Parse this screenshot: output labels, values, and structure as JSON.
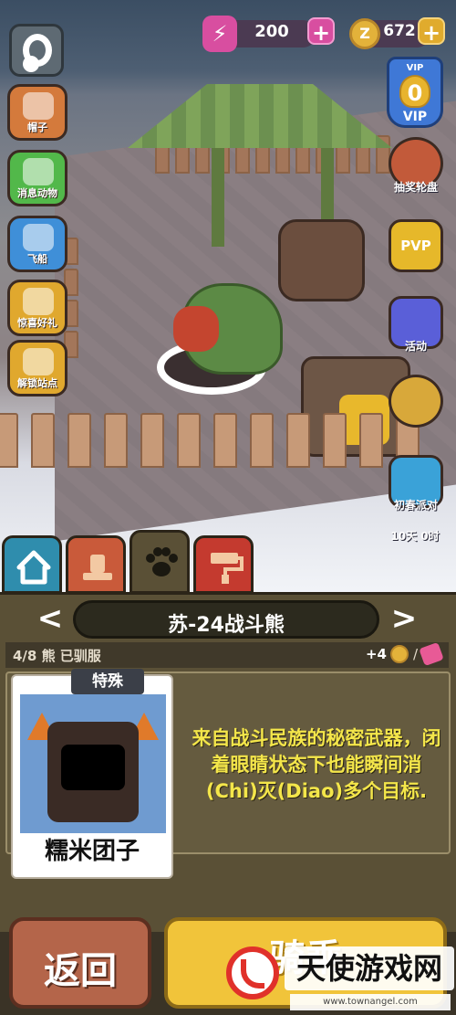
{
  "top_bar": {
    "energy_value": "200",
    "coin_icon_glyph": "Z",
    "coin_value": "672",
    "plus_label": "+"
  },
  "left_menu": [
    {
      "label": "帽子",
      "icon": "hat-icon",
      "color": "#d47a3c"
    },
    {
      "label": "消息动物",
      "icon": "paw-icon",
      "color": "#52b84a"
    },
    {
      "label": "飞船",
      "icon": "spaceship-icon",
      "color": "#3f8fd8"
    },
    {
      "label": "惊喜好礼",
      "icon": "gift-icon",
      "color": "#e0a82e"
    },
    {
      "label": "解锁站点",
      "icon": "unlock-icon",
      "color": "#e0a82e"
    }
  ],
  "right_menu": {
    "vip_top": "VIP",
    "vip_level": "0",
    "vip_label": "VIP",
    "items": [
      {
        "label": "抽奖轮盘",
        "icon": "wheel-icon",
        "color": "#c25a3a"
      },
      {
        "label": "PVP",
        "icon": "trophy-icon",
        "color": "#e6b82a"
      },
      {
        "label": "活动",
        "icon": "gift-box-icon",
        "color": "#5a5fd8"
      },
      {
        "label": "",
        "icon": "egg-icon",
        "color": "#d8a83a"
      },
      {
        "label": "初春派对",
        "icon": "whale-icon",
        "color": "#3aa2d8"
      }
    ],
    "timer": "10天 0时"
  },
  "tabs": [
    {
      "name": "home",
      "icon": "house-icon"
    },
    {
      "name": "hat",
      "icon": "hat-tab-icon"
    },
    {
      "name": "animals",
      "icon": "paw-tab-icon",
      "active": true
    },
    {
      "name": "tools",
      "icon": "paint-roller-icon"
    }
  ],
  "panel": {
    "title": "苏-24战斗熊",
    "prev_arrow": "<",
    "next_arrow": ">",
    "tame_status": "4/8 熊 已驯服",
    "bonus": "+4",
    "slash": "/",
    "card_badge": "特殊",
    "card_name": "糯米团子",
    "description": "来自战斗民族的秘密武器，闭着眼睛状态下也能瞬间消(Chi)灭(Diao)多个目标."
  },
  "buttons": {
    "back": "返回",
    "ride": "骑乘"
  },
  "watermark": {
    "text": "天使游戏网",
    "url": "www.townangel.com"
  },
  "colors": {
    "panel_bg": "#5a5036",
    "title_text": "#ffffff",
    "description_text": "#f4e64a",
    "back_button": "#b4654a",
    "ride_button": "#f1c43a"
  }
}
